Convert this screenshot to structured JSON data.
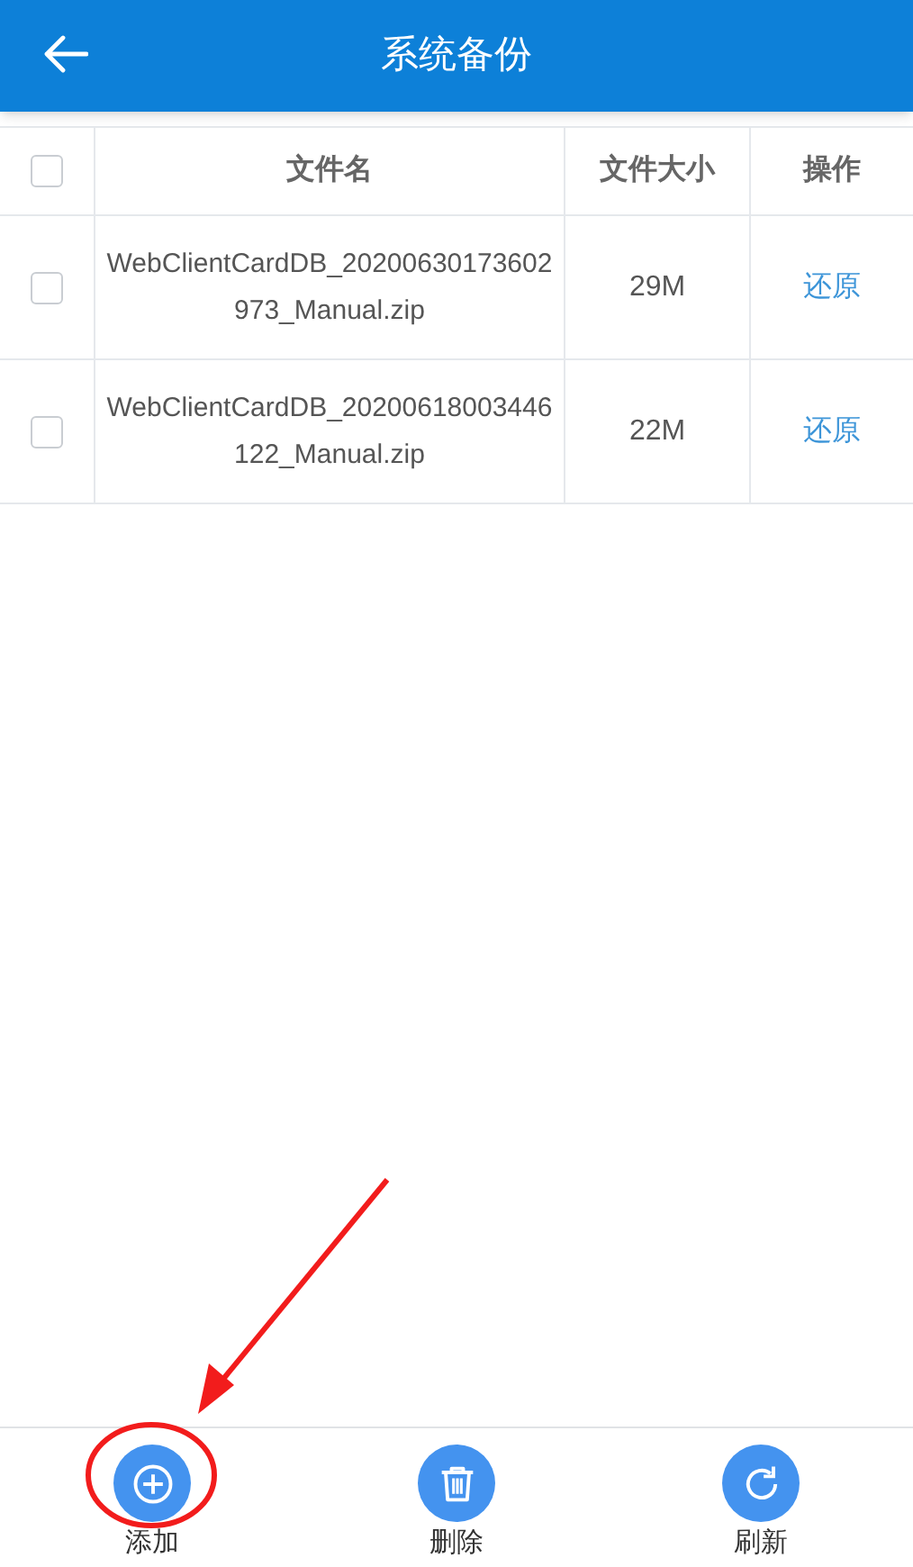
{
  "header": {
    "title": "系统备份"
  },
  "table": {
    "select_all": {
      "checked": false
    },
    "columns": [
      "文件名",
      "文件大小",
      "操作"
    ],
    "rows": [
      {
        "checked": false,
        "file_name": "WebClientCardDB_20200630173602973_Manual.zip",
        "size": "29M",
        "action": "还原"
      },
      {
        "checked": false,
        "file_name": "WebClientCardDB_20200618003446122_Manual.zip",
        "size": "22M",
        "action": "还原"
      }
    ]
  },
  "toolbar": [
    {
      "kind": "add",
      "label": "添加"
    },
    {
      "kind": "delete",
      "label": "删除"
    },
    {
      "kind": "refresh",
      "label": "刷新"
    }
  ]
}
